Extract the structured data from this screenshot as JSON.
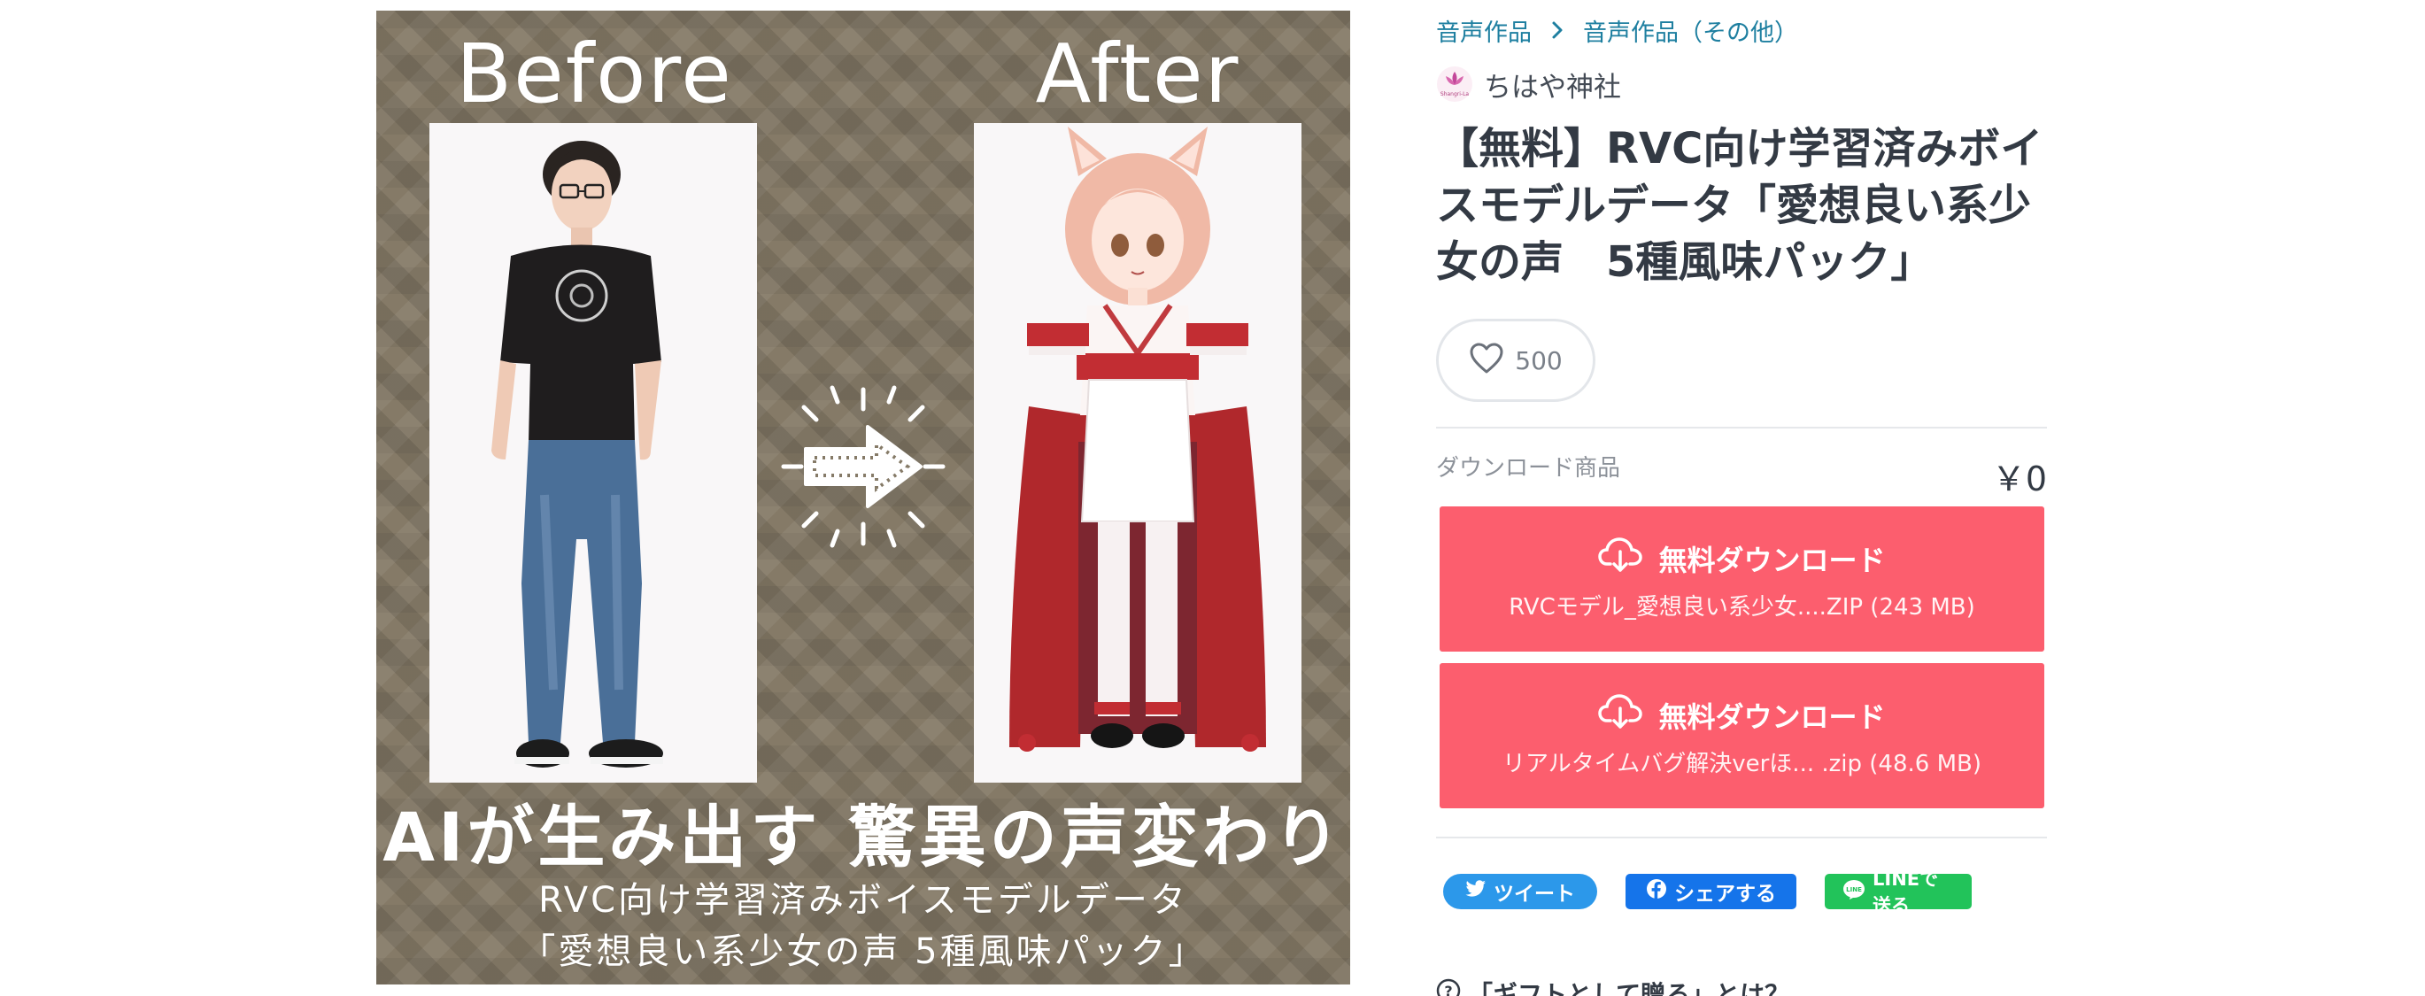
{
  "product_image": {
    "before_label": "Before",
    "after_label": "After",
    "main_caption": "AIが生み出す 驚異の声変わり",
    "sub_caption_1": "RVC向け学習済みボイスモデルデータ",
    "sub_caption_2": "「愛想良い系少女の声 5種風味パック」"
  },
  "breadcrumb": {
    "items": [
      "音声作品",
      "音声作品（その他）"
    ]
  },
  "shop": {
    "name": "ちはや神社",
    "logo_text": "Shangri-La"
  },
  "product": {
    "title": "【無料】RVC向け学習済みボイスモデルデータ「愛想良い系少女の声　5種風味パック」",
    "likes": "500"
  },
  "variant": {
    "label": "ダウンロード商品",
    "price": "￥0"
  },
  "downloads": [
    {
      "label": "無料ダウンロード",
      "file": "RVCモデル_愛想良い系少女....ZIP (243 MB)"
    },
    {
      "label": "無料ダウンロード",
      "file": "リアルタイムバグ解決verほ...  .zip (48.6 MB)"
    }
  ],
  "share": {
    "tweet": "ツイート",
    "facebook": "シェアする",
    "line": "LINEで送る"
  },
  "gift": {
    "label": "「ギフトとして贈る」とは？"
  },
  "colors": {
    "accent_link": "#1e7fa0",
    "download_button": "#fc5e6e",
    "twitter": "#2c98ea",
    "facebook": "#1574ea",
    "line": "#22c35a",
    "image_background": "#857a67"
  },
  "icons": [
    "chevron-right-icon",
    "heart-icon",
    "cloud-download-icon",
    "twitter-bird-icon",
    "facebook-icon",
    "line-icon",
    "question-circle-icon"
  ]
}
